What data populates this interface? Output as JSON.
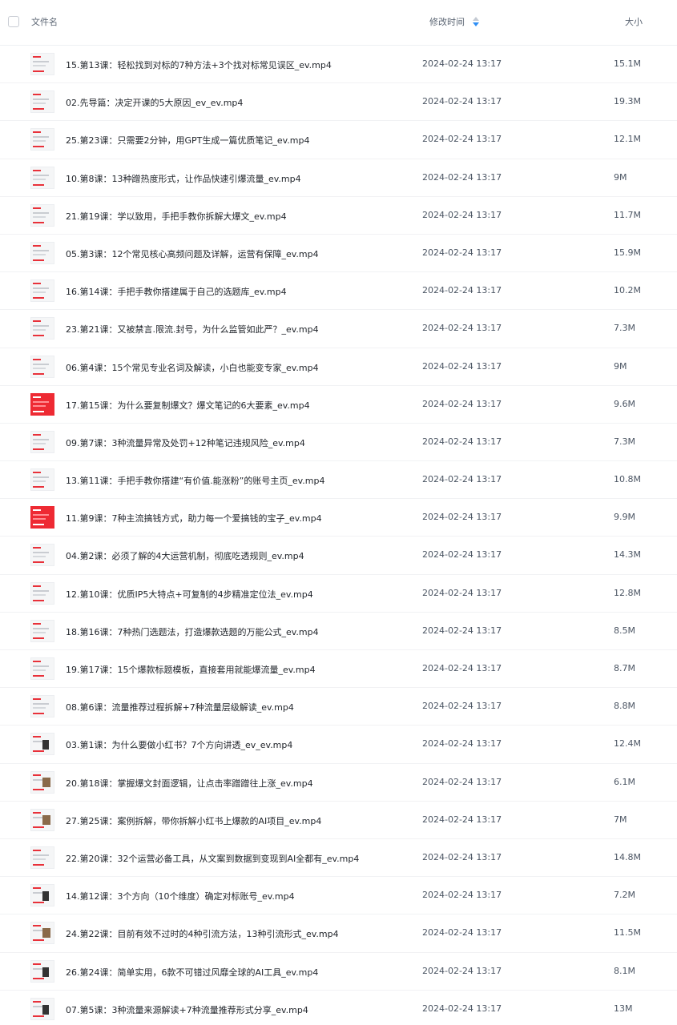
{
  "header": {
    "name_label": "文件名",
    "time_label": "修改时间",
    "size_label": "大小",
    "sort_icon": "sort-desc-icon",
    "accent_color": "#2f8ff5"
  },
  "files": [
    {
      "name": "15.第13课：轻松找到对标的7种方法+3个找对标常见误区_ev.mp4",
      "time": "2024-02-24 13:17",
      "size": "15.1M",
      "thumb": "slide"
    },
    {
      "name": "02.先导篇：决定开课的5大原因_ev_ev.mp4",
      "time": "2024-02-24 13:17",
      "size": "19.3M",
      "thumb": "slide"
    },
    {
      "name": "25.第23课：只需要2分钟，用GPT生成一篇优质笔记_ev.mp4",
      "time": "2024-02-24 13:17",
      "size": "12.1M",
      "thumb": "slide"
    },
    {
      "name": "10.第8课：13种蹭热度形式，让作品快速引爆流量_ev.mp4",
      "time": "2024-02-24 13:17",
      "size": "9M",
      "thumb": "slide"
    },
    {
      "name": "21.第19课：学以致用，手把手教你拆解大爆文_ev.mp4",
      "time": "2024-02-24 13:17",
      "size": "11.7M",
      "thumb": "slide"
    },
    {
      "name": "05.第3课：12个常见核心高频问题及详解，运营有保障_ev.mp4",
      "time": "2024-02-24 13:17",
      "size": "15.9M",
      "thumb": "slide"
    },
    {
      "name": "16.第14课：手把手教你搭建属于自己的选题库_ev.mp4",
      "time": "2024-02-24 13:17",
      "size": "10.2M",
      "thumb": "slide"
    },
    {
      "name": "23.第21课：又被禁言.限流.封号，为什么监管如此严？_ev.mp4",
      "time": "2024-02-24 13:17",
      "size": "7.3M",
      "thumb": "slide"
    },
    {
      "name": "06.第4课：15个常见专业名词及解读，小白也能变专家_ev.mp4",
      "time": "2024-02-24 13:17",
      "size": "9M",
      "thumb": "slide"
    },
    {
      "name": "17.第15课：为什么要复制爆文？爆文笔记的6大要素_ev.mp4",
      "time": "2024-02-24 13:17",
      "size": "9.6M",
      "thumb": "red"
    },
    {
      "name": "09.第7课：3种流量异常及处罚+12种笔记违规风险_ev.mp4",
      "time": "2024-02-24 13:17",
      "size": "7.3M",
      "thumb": "slide"
    },
    {
      "name": "13.第11课：手把手教你搭建“有价值.能涨粉”的账号主页_ev.mp4",
      "time": "2024-02-24 13:17",
      "size": "10.8M",
      "thumb": "slide"
    },
    {
      "name": "11.第9课：7种主流搞钱方式，助力每一个爱搞钱的宝子_ev.mp4",
      "time": "2024-02-24 13:17",
      "size": "9.9M",
      "thumb": "red"
    },
    {
      "name": "04.第2课：必须了解的4大运营机制，彻底吃透规则_ev.mp4",
      "time": "2024-02-24 13:17",
      "size": "14.3M",
      "thumb": "slide"
    },
    {
      "name": "12.第10课：优质IP5大特点+可复制的4步精准定位法_ev.mp4",
      "time": "2024-02-24 13:17",
      "size": "12.8M",
      "thumb": "slide"
    },
    {
      "name": "18.第16课：7种热门选题法，打造爆款选题的万能公式_ev.mp4",
      "time": "2024-02-24 13:17",
      "size": "8.5M",
      "thumb": "slide"
    },
    {
      "name": "19.第17课：15个爆款标题模板，直接套用就能爆流量_ev.mp4",
      "time": "2024-02-24 13:17",
      "size": "8.7M",
      "thumb": "slide"
    },
    {
      "name": "08.第6课：流量推荐过程拆解+7种流量层级解读_ev.mp4",
      "time": "2024-02-24 13:17",
      "size": "8.8M",
      "thumb": "slide"
    },
    {
      "name": "03.第1课：为什么要做小红书？7个方向讲透_ev_ev.mp4",
      "time": "2024-02-24 13:17",
      "size": "12.4M",
      "thumb": "dark"
    },
    {
      "name": "20.第18课：掌握爆文封面逻辑，让点击率蹭蹭往上涨_ev.mp4",
      "time": "2024-02-24 13:17",
      "size": "6.1M",
      "thumb": "photo"
    },
    {
      "name": "27.第25课：案例拆解，带你拆解小红书上爆款的AI项目_ev.mp4",
      "time": "2024-02-24 13:17",
      "size": "7M",
      "thumb": "photo"
    },
    {
      "name": "22.第20课：32个运营必备工具，从文案到数据到变现到AI全都有_ev.mp4",
      "time": "2024-02-24 13:17",
      "size": "14.8M",
      "thumb": "slide"
    },
    {
      "name": "14.第12课：3个方向（10个维度）确定对标账号_ev.mp4",
      "time": "2024-02-24 13:17",
      "size": "7.2M",
      "thumb": "dark"
    },
    {
      "name": "24.第22课：目前有效不过时的4种引流方法，13种引流形式_ev.mp4",
      "time": "2024-02-24 13:17",
      "size": "11.5M",
      "thumb": "photo"
    },
    {
      "name": "26.第24课：简单实用，6款不可错过风靡全球的AI工具_ev.mp4",
      "time": "2024-02-24 13:17",
      "size": "8.1M",
      "thumb": "dark"
    },
    {
      "name": "07.第5课：3种流量来源解读+7种流量推荐形式分享_ev.mp4",
      "time": "2024-02-24 13:17",
      "size": "13M",
      "thumb": "dark"
    }
  ]
}
